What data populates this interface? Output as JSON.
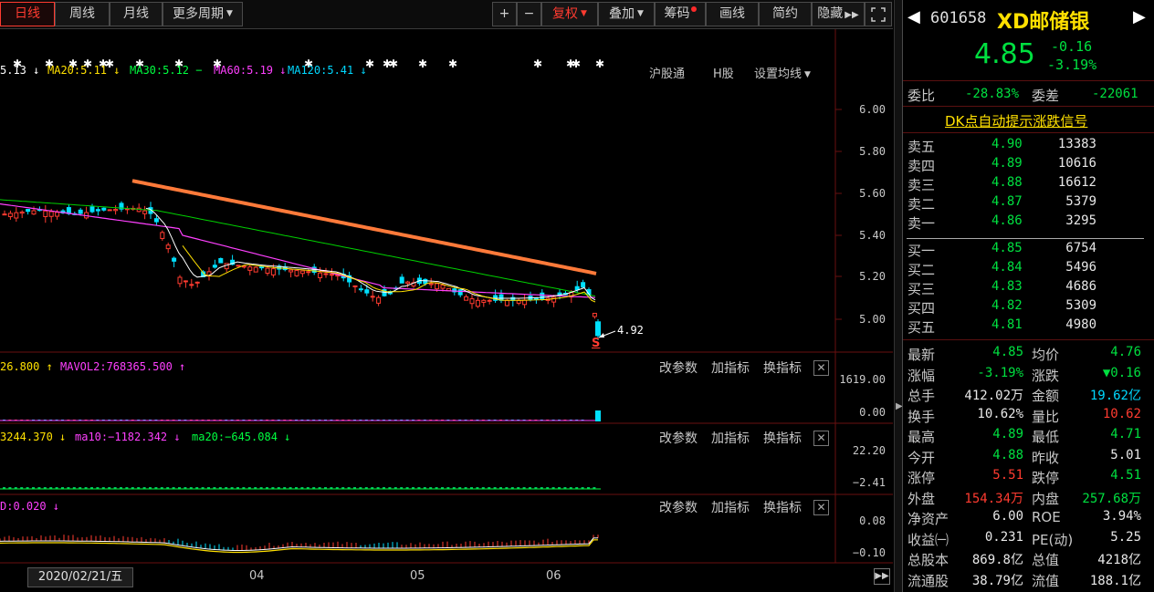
{
  "toolbar": {
    "periods": [
      "日线",
      "周线",
      "月线",
      "更多周期"
    ],
    "tools": [
      "+",
      "−",
      "复权",
      "叠加",
      "筹码",
      "画线",
      "简约",
      "隐藏"
    ],
    "maximize_icon": "expand-icon"
  },
  "ma_legend": [
    {
      "text": "5.13 ↓",
      "color": "#ffffff"
    },
    {
      "text": "MA20:5.11 ↓",
      "color": "#ffe000"
    },
    {
      "text": "MA30:5.12 −",
      "color": "#00ff40"
    },
    {
      "text": "MA60:5.19 ↓",
      "color": "#ff40ff"
    },
    {
      "text": "MA120:5.41 ↓",
      "color": "#00d8ff"
    }
  ],
  "chart_links": {
    "hs": "沪股通",
    "h": "H股",
    "settings": "设置均线"
  },
  "price_axis": [
    "6.00",
    "5.80",
    "5.60",
    "5.40",
    "5.20",
    "5.00"
  ],
  "low_marker": "4.92",
  "signal_marker": "S",
  "volume_legend": {
    "left": "26.800 ↑",
    "mavol2": "MAVOL2:768365.500 ↑"
  },
  "volume_axis": [
    "1619.00",
    "0.00"
  ],
  "ind2_legend": {
    "a": "3244.370 ↓",
    "b": "ma10:−1182.342 ↓",
    "c": "ma20:−645.084 ↓"
  },
  "ind2_axis": [
    "22.20",
    "−2.41"
  ],
  "ind3_legend": "D:0.020 ↓",
  "ind3_axis": [
    "0.08",
    "−0.10"
  ],
  "sub_buttons": {
    "params": "改参数",
    "add": "加指标",
    "switch": "换指标"
  },
  "x_axis": {
    "cursor_date": "2020/02/21/五",
    "months": [
      "04",
      "05",
      "06"
    ]
  },
  "chart_data": {
    "type": "candlestick",
    "ma_values": {
      "MA20": 5.11,
      "MA30": 5.12,
      "MA60": 5.19,
      "MA120": 5.41
    },
    "ylim": [
      4.9,
      6.1
    ],
    "last_price": 4.85,
    "marked_low": 4.92
  },
  "stock": {
    "code": "601658",
    "name": "XD邮储银",
    "price": "4.85",
    "change": "-0.16",
    "change_pct": "-3.19%"
  },
  "order_ratio": {
    "label1": "委比",
    "v1": "-28.83%",
    "label2": "委差",
    "v2": "-22061"
  },
  "dk_link": "DK点自动提示涨跌信号",
  "asks": [
    {
      "label": "卖五",
      "price": "4.90",
      "vol": "13383"
    },
    {
      "label": "卖四",
      "price": "4.89",
      "vol": "10616"
    },
    {
      "label": "卖三",
      "price": "4.88",
      "vol": "16612"
    },
    {
      "label": "卖二",
      "price": "4.87",
      "vol": "5379"
    },
    {
      "label": "卖一",
      "price": "4.86",
      "vol": "3295"
    }
  ],
  "bids": [
    {
      "label": "买一",
      "price": "4.85",
      "vol": "6754"
    },
    {
      "label": "买二",
      "price": "4.84",
      "vol": "5496"
    },
    {
      "label": "买三",
      "price": "4.83",
      "vol": "4686"
    },
    {
      "label": "买四",
      "price": "4.82",
      "vol": "5309"
    },
    {
      "label": "买五",
      "price": "4.81",
      "vol": "4980"
    }
  ],
  "stats": [
    {
      "l1": "最新",
      "v1": "4.85",
      "c1": "grn",
      "l2": "均价",
      "v2": "4.76",
      "c2": "grn"
    },
    {
      "l1": "涨幅",
      "v1": "-3.19%",
      "c1": "grn",
      "l2": "涨跌",
      "v2": "▼0.16",
      "c2": "grn"
    },
    {
      "l1": "总手",
      "v1": "412.02万",
      "c1": "wht",
      "l2": "金额",
      "v2": "19.62亿",
      "c2": "cyan"
    },
    {
      "l1": "换手",
      "v1": "10.62%",
      "c1": "wht",
      "l2": "量比",
      "v2": "10.62",
      "c2": "red"
    },
    {
      "l1": "最高",
      "v1": "4.89",
      "c1": "grn",
      "l2": "最低",
      "v2": "4.71",
      "c2": "grn"
    },
    {
      "l1": "今开",
      "v1": "4.88",
      "c1": "grn",
      "l2": "昨收",
      "v2": "5.01",
      "c2": "wht"
    },
    {
      "l1": "涨停",
      "v1": "5.51",
      "c1": "red",
      "l2": "跌停",
      "v2": "4.51",
      "c2": "grn"
    },
    {
      "l1": "外盘",
      "v1": "154.34万",
      "c1": "red",
      "l2": "内盘",
      "v2": "257.68万",
      "c2": "grn"
    },
    {
      "l1": "净资产",
      "v1": "6.00",
      "c1": "wht",
      "l2": "ROE",
      "v2": "3.94%",
      "c2": "wht"
    },
    {
      "l1": "收益㈠",
      "v1": "0.231",
      "c1": "wht",
      "l2": "PE(动)",
      "v2": "5.25",
      "c2": "wht"
    },
    {
      "l1": "总股本",
      "v1": "869.8亿",
      "c1": "wht",
      "l2": "总值",
      "v2": "4218亿",
      "c2": "wht"
    },
    {
      "l1": "流通股",
      "v1": "38.79亿",
      "c1": "wht",
      "l2": "流值",
      "v2": "188.1亿",
      "c2": "wht"
    }
  ]
}
